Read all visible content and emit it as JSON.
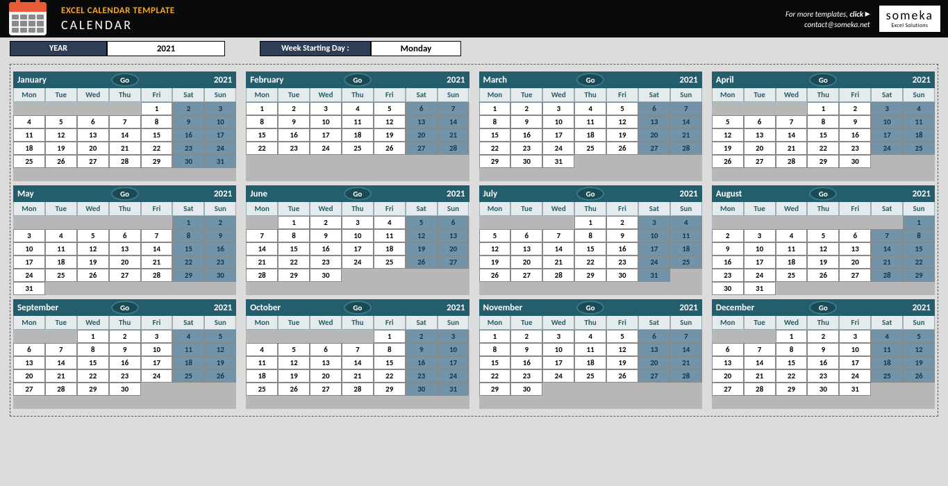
{
  "banner": {
    "title_small": "EXCEL CALENDAR TEMPLATE",
    "title_large": "CALENDAR",
    "more_templates": "For more templates, ",
    "click": "click",
    "arrow": "▸",
    "contact": "contact@someka.net",
    "logo_big": "someka",
    "logo_small": "Excel Solutions"
  },
  "controls": {
    "year_label": "YEAR",
    "year_value": "2021",
    "wsd_label": "Week Starting Day :",
    "wsd_value": "Monday"
  },
  "dow": [
    "Mon",
    "Tue",
    "Wed",
    "Thu",
    "Fri",
    "Sat",
    "Sun"
  ],
  "go_label": "Go",
  "months": [
    {
      "name": "January",
      "year": "2021",
      "offset": 4,
      "days": 31,
      "rows": 5
    },
    {
      "name": "February",
      "year": "2021",
      "offset": 0,
      "days": 28,
      "rows": 5
    },
    {
      "name": "March",
      "year": "2021",
      "offset": 0,
      "days": 31,
      "rows": 5
    },
    {
      "name": "April",
      "year": "2021",
      "offset": 3,
      "days": 30,
      "rows": 5
    },
    {
      "name": "May",
      "year": "2021",
      "offset": 5,
      "days": 31,
      "rows": 6
    },
    {
      "name": "June",
      "year": "2021",
      "offset": 1,
      "days": 30,
      "rows": 6
    },
    {
      "name": "July",
      "year": "2021",
      "offset": 3,
      "days": 31,
      "rows": 6
    },
    {
      "name": "August",
      "year": "2021",
      "offset": 6,
      "days": 31,
      "rows": 6
    },
    {
      "name": "September",
      "year": "2021",
      "offset": 2,
      "days": 30,
      "rows": 5
    },
    {
      "name": "October",
      "year": "2021",
      "offset": 4,
      "days": 31,
      "rows": 5
    },
    {
      "name": "November",
      "year": "2021",
      "offset": 0,
      "days": 30,
      "rows": 5
    },
    {
      "name": "December",
      "year": "2021",
      "offset": 2,
      "days": 31,
      "rows": 5
    }
  ]
}
